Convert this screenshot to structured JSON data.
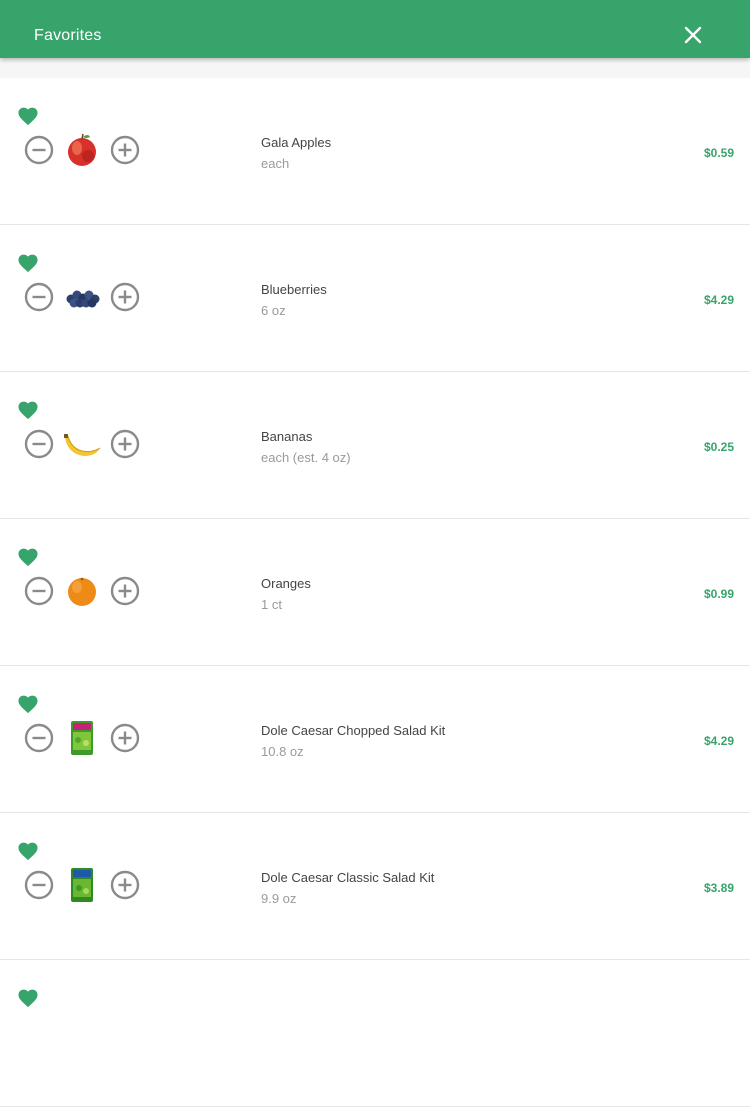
{
  "header": {
    "title": "Favorites",
    "close_icon": "close-icon"
  },
  "colors": {
    "brand": "#37a56b",
    "icon_gray": "#8a8a8a"
  },
  "items": [
    {
      "name": "Gala Apples",
      "size": "each",
      "price": "$0.59",
      "image": "apple-image"
    },
    {
      "name": "Blueberries",
      "size": "6 oz",
      "price": "$4.29",
      "image": "blueberries-image"
    },
    {
      "name": "Bananas",
      "size": "each (est. 4 oz)",
      "price": "$0.25",
      "image": "banana-image"
    },
    {
      "name": "Oranges",
      "size": "1 ct",
      "price": "$0.99",
      "image": "orange-image"
    },
    {
      "name": "Dole Caesar Chopped Salad Kit",
      "size": "10.8 oz",
      "price": "$4.29",
      "image": "salad-kit-image"
    },
    {
      "name": "Dole Caesar Classic Salad Kit",
      "size": "9.9 oz",
      "price": "$3.89",
      "image": "salad-kit-image"
    }
  ]
}
